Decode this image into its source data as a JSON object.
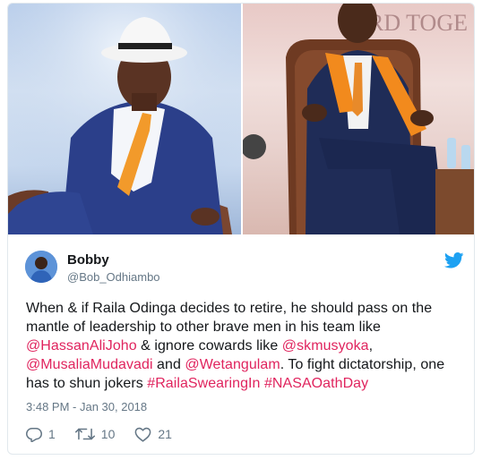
{
  "tweet": {
    "author": {
      "name": "Bobby",
      "handle": "@Bob_Odhiambo"
    },
    "images": {
      "left_photo_label": "Man in white hat and blue suit with orange tie seated in armchair",
      "right_photo_label": "Man in blue suit with orange sash seated in wooden armchair",
      "backdrop_text": "RD TOGE"
    },
    "text": {
      "segment_1": "When & if Raila Odinga decides to retire, he should pass on the mantle of leadership to other brave men in his team like ",
      "mention_1": "@HassanAliJoho",
      "segment_2": " & ignore cowards like ",
      "mention_2": "@skmusyoka",
      "segment_3": ", ",
      "mention_3": "@MusaliaMudavadi",
      "segment_4": " and ",
      "mention_4": "@Wetangulam",
      "segment_5": ". To fight dictatorship, one has to shun jokers ",
      "hashtag_1": "#RailaSwearingIn",
      "segment_6": " ",
      "hashtag_2": "#NASAOathDay"
    },
    "timestamp": "3:48 PM - Jan 30, 2018",
    "stats": {
      "replies": "1",
      "retweets": "10",
      "likes": "21"
    },
    "colors": {
      "link": "#e0245e",
      "muted": "#657786",
      "twitter_blue": "#1da1f2",
      "border": "#e1e8ed"
    }
  }
}
